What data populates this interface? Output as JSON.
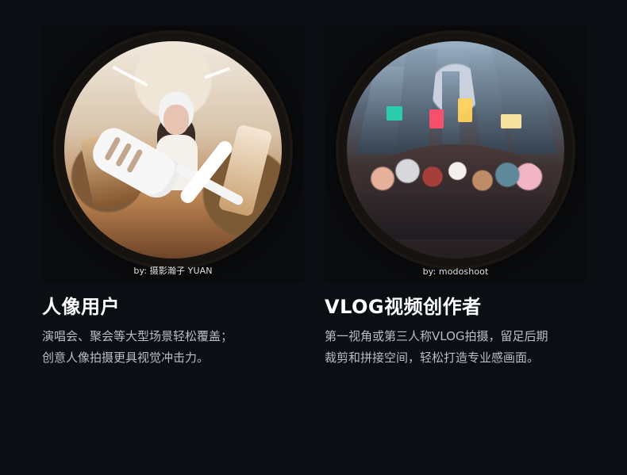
{
  "cards": [
    {
      "caption": "by: 摄影瀚子 YUAN",
      "title": "人像用户",
      "description_lines": [
        "演唱会、聚会等大型场景轻松覆盖；",
        "创意人像拍摄更具视觉冲击力。"
      ]
    },
    {
      "caption": "by: modoshoot",
      "title": "VLOG视频创作者",
      "description_lines": [
        "第一视角或第三人称VLOG拍摄，留足后期",
        "裁剪和拼接空间，轻松打造专业感画面。"
      ]
    }
  ],
  "theme": {
    "background": "#0b0f14",
    "title_color": "#ffffff",
    "description_color": "#b9bec4",
    "caption_color": "#f5f5f5"
  }
}
